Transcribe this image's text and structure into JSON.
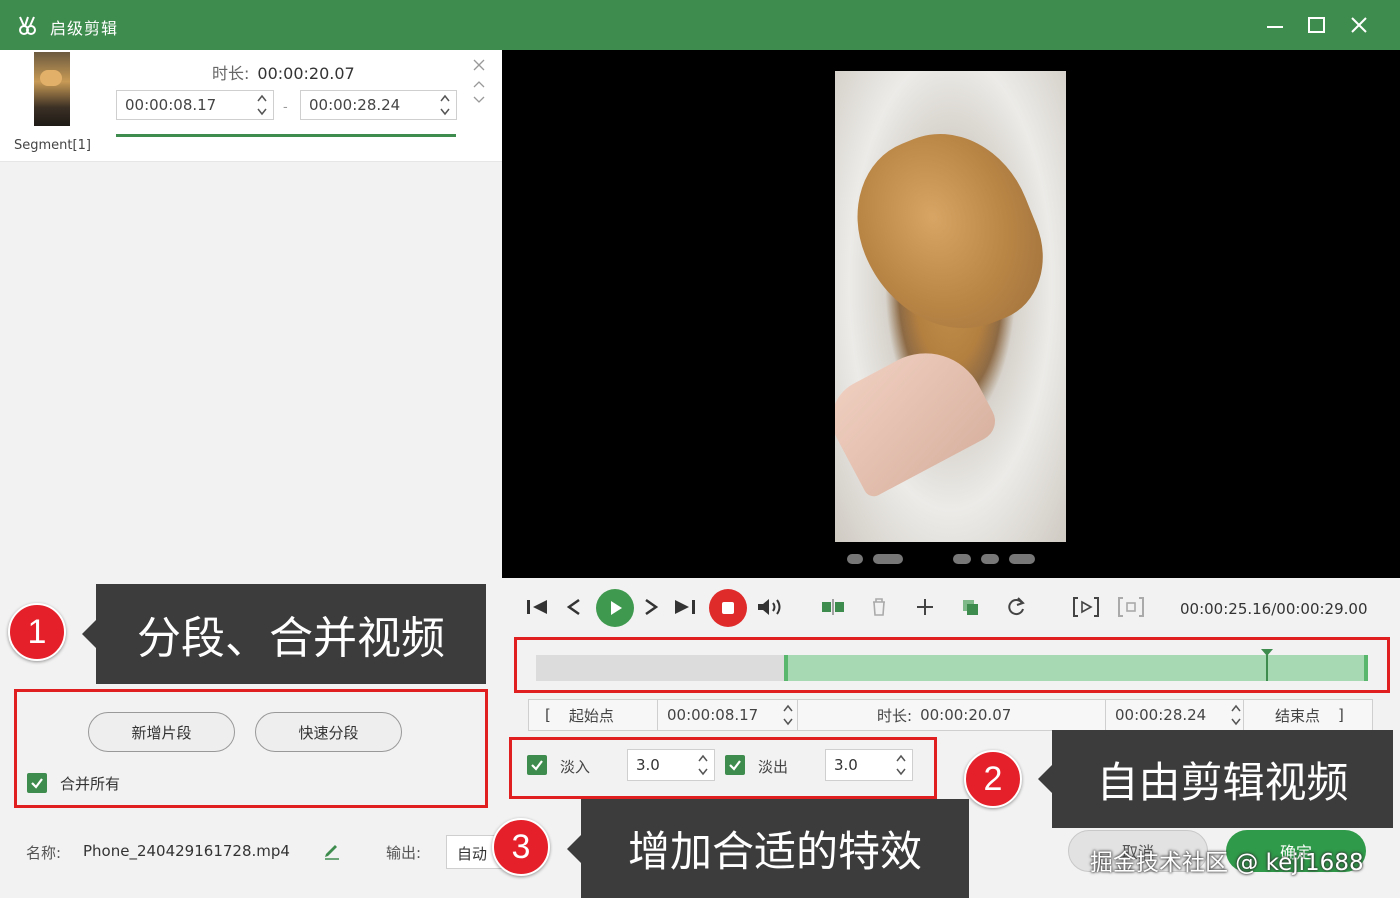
{
  "window": {
    "title": "启级剪辑",
    "accent_color": "#3f8c4f",
    "controls": [
      "minimize-icon",
      "maximize-icon",
      "close-icon"
    ]
  },
  "segment": {
    "label": "Segment[1]",
    "duration_label": "时长:",
    "duration_value": "00:00:20.07",
    "start": "00:00:08.17",
    "end": "00:00:28.24",
    "separator": "-"
  },
  "player": {
    "time_readout": "00:00:25.16/00:00:29.00",
    "selection_start_fraction": 0.298,
    "selection_end_fraction": 1.0,
    "cursor_fraction": 0.878
  },
  "range": {
    "start_bracket": "[",
    "start_label": "起始点",
    "start_value": "00:00:08.17",
    "duration_label": "时长:",
    "duration_value": "00:00:20.07",
    "end_value": "00:00:28.24",
    "end_label": "结束点",
    "end_bracket": "]"
  },
  "fade": {
    "fade_in_label": "淡入",
    "fade_in_value": "3.0",
    "fade_out_label": "淡出",
    "fade_out_value": "3.0",
    "fade_in_checked": true,
    "fade_out_checked": true
  },
  "segment_actions": {
    "add_segment": "新增片段",
    "quick_split": "快速分段",
    "merge_all_label": "合并所有",
    "merge_all_checked": true
  },
  "footer": {
    "name_label": "名称:",
    "name_value": "Phone_240429161728.mp4",
    "output_label": "输出:",
    "output_value": "自动",
    "cancel_label": "取消",
    "confirm_label": "确定"
  },
  "annotations": {
    "n1": "1",
    "t1": "分段、合并视频",
    "n2": "2",
    "t2": "自由剪辑视频",
    "n3": "3",
    "t3": "增加合适的特效"
  },
  "watermark": "掘金技术社区 @ keji1688"
}
